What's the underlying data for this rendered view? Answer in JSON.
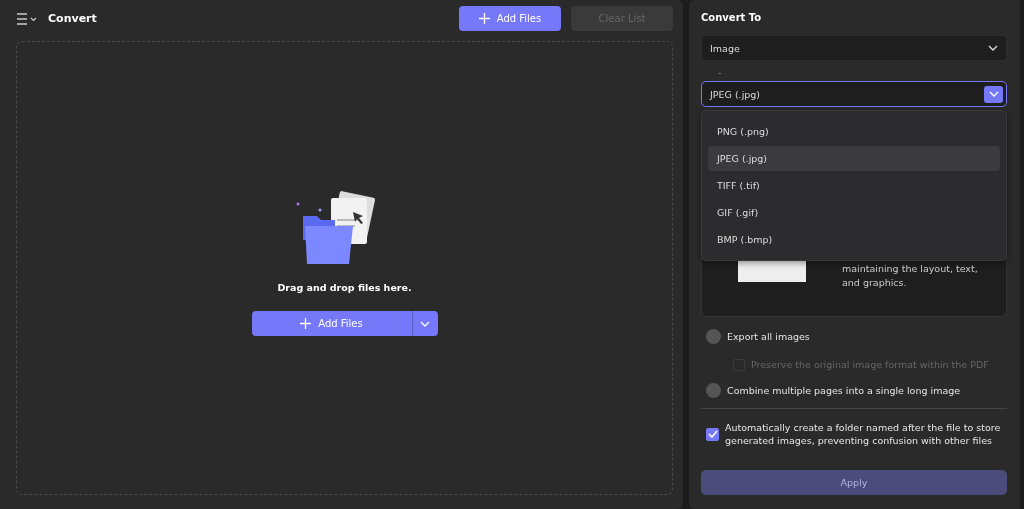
{
  "header": {
    "title": "Convert",
    "add_button": "Add Files",
    "clear_button": {
      "label": "Clear List",
      "disabled": true
    }
  },
  "dropzone": {
    "text": "Drag and drop files here.",
    "add_button": "Add Files"
  },
  "panel": {
    "title": "Convert To",
    "type_select": {
      "value": "Image"
    },
    "separator": "-",
    "format_select": {
      "value": "JPEG (.jpg)",
      "expanded": true
    },
    "format_options": [
      {
        "label": "PNG (.png)",
        "selected": false
      },
      {
        "label": "JPEG (.jpg)",
        "selected": true
      },
      {
        "label": "TIFF (.tif)",
        "selected": false
      },
      {
        "label": "GIF (.gif)",
        "selected": false
      },
      {
        "label": "BMP (.bmp)",
        "selected": false
      }
    ],
    "preview_text": "maintaining the layout, text, and graphics.",
    "options": [
      {
        "kind": "radio",
        "label": "Export all images",
        "checked": false
      },
      {
        "kind": "checkbox",
        "label": "Preserve the original image format within the PDF",
        "checked": false,
        "disabled": true,
        "indent": true
      },
      {
        "kind": "radio",
        "label": "Combine multiple pages into a single long image",
        "checked": false
      },
      {
        "kind": "divider"
      },
      {
        "kind": "checkbox",
        "label": "Automatically create a folder named after the file to store generated images, preventing confusion with other files",
        "checked": true
      }
    ],
    "apply_button": {
      "label": "Apply",
      "disabled": true
    }
  }
}
